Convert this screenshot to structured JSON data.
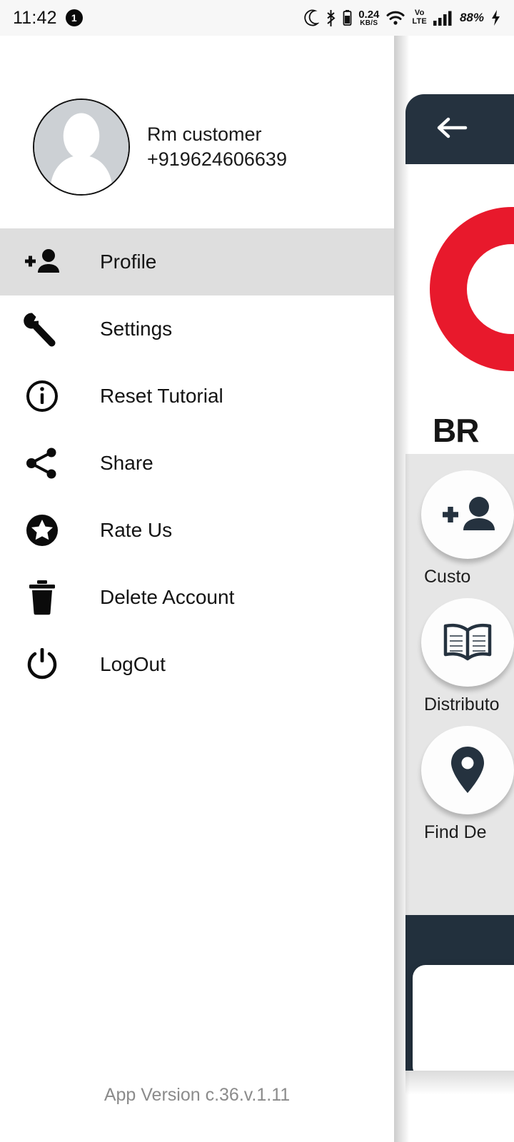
{
  "status_bar": {
    "clock": "11:42",
    "notification_count": "1",
    "icons": [
      "moon-icon",
      "bluetooth-icon",
      "battery-icon",
      "wifi-icon",
      "signal-bars-icon",
      "charging-bolt-icon"
    ],
    "network_speed_value": "0.24",
    "network_speed_unit": "KB/S",
    "volte_line1": "Vo",
    "volte_line2": "LTE",
    "battery_percent": "88%"
  },
  "drawer": {
    "profile": {
      "avatar_icon": "default-person-avatar",
      "name": "Rm customer",
      "phone": "+919624606639"
    },
    "items": [
      {
        "label": "Profile",
        "icon": "person-add-icon",
        "active": true
      },
      {
        "label": "Settings",
        "icon": "wrench-icon",
        "active": false
      },
      {
        "label": "Reset Tutorial",
        "icon": "info-circle-icon",
        "active": false
      },
      {
        "label": "Share",
        "icon": "share-nodes-icon",
        "active": false
      },
      {
        "label": "Rate Us",
        "icon": "star-circle-icon",
        "active": false
      },
      {
        "label": "Delete Account",
        "icon": "trash-icon",
        "active": false
      },
      {
        "label": "LogOut",
        "icon": "power-icon",
        "active": false
      }
    ],
    "app_version": "App Version c.36.v.1.11"
  },
  "app_panel": {
    "appbar": {
      "back_icon": "arrow-left-icon"
    },
    "brand_text": "BR",
    "logo": {
      "shape": "red-ring-logo",
      "color": "#e8192c"
    },
    "tiles": [
      {
        "label": "Custo",
        "icon": "person-add-icon"
      },
      {
        "label": "Distributo",
        "icon": "open-book-icon"
      },
      {
        "label": "Find De",
        "icon": "location-pin-icon"
      }
    ]
  },
  "colors": {
    "navy": "#25323f",
    "brand_red": "#e8192c",
    "selected_row": "#dedede",
    "panel_bg": "#e6e6e6",
    "status_bar_bg": "#f7f7f7",
    "muted_text": "#8b8b8b"
  }
}
